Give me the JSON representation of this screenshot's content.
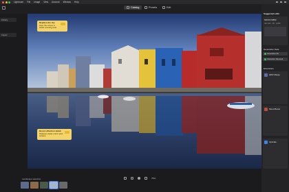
{
  "colors": {
    "accent": "#3b82f6",
    "note": "#f3d36a",
    "success": "#34c759"
  },
  "menubar": {
    "items": [
      "Lightroom",
      "File",
      "Image",
      "View",
      "Account",
      "Window",
      "Help"
    ]
  },
  "toolbar": {
    "tabs": [
      {
        "label": "Catalog",
        "icon": "grid-icon",
        "active": true
      },
      {
        "label": "Presets",
        "icon": "presets-icon",
        "active": false
      },
      {
        "label": "Edit",
        "icon": "edit-icon",
        "active": false
      }
    ]
  },
  "left": {
    "buttons": [
      "Library",
      "Import"
    ]
  },
  "notes": {
    "top": {
      "title": "Replace the sky",
      "body": "Give the scene a softer evening look"
    },
    "bottom": {
      "title": "Boost reflection detail",
      "body": "Sharpen water mirror and colours"
    }
  },
  "bottom": {
    "label": "Landscape selection",
    "zoom": "75%"
  },
  "right": {
    "header": "Suggested edits",
    "camera": "NIKON D850",
    "meta": "ISO 100 · f/8 · 1/250",
    "section_a": "Generative Tools",
    "actions": [
      "Generative Fill",
      "Distraction Removal"
    ],
    "section_b": "Extensions",
    "cards": [
      {
        "title": "HDR Merge"
      },
      {
        "title": "Mood Boost"
      },
      {
        "title": "Upscale"
      }
    ]
  }
}
